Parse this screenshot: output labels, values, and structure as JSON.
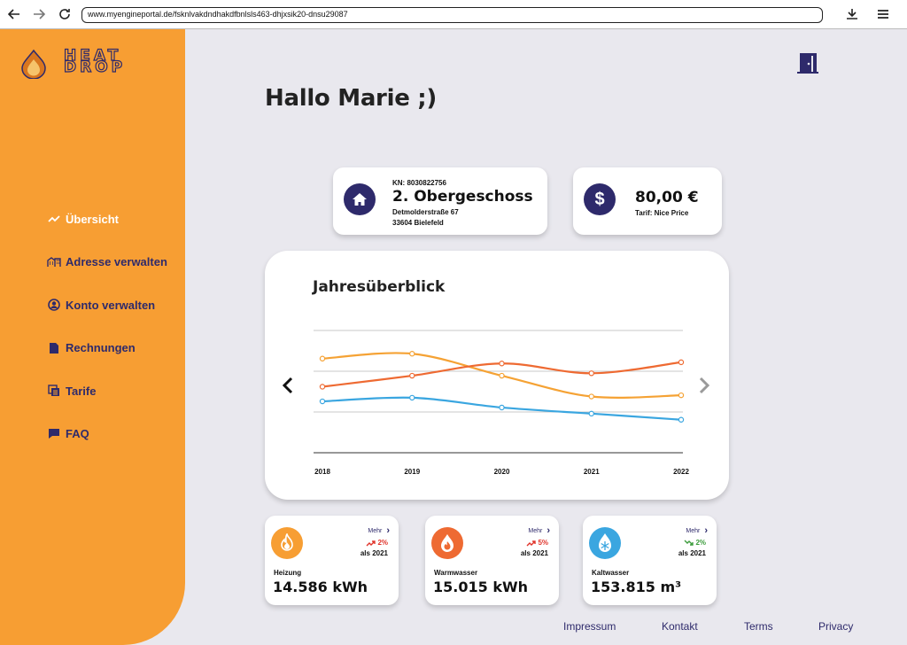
{
  "browser": {
    "url": "www.myengineportal.de/fsknlvakdndhakdfbnlsls463-dhjxsik20-dnsu29087"
  },
  "brand": {
    "logo_line1": "HEAT",
    "logo_line2": "DROP",
    "accent": "#f79e33",
    "navy": "#2e2a6b"
  },
  "sidebar": {
    "items": [
      {
        "label": "Übersicht",
        "icon": "trend-line-icon",
        "active": true
      },
      {
        "label": "Adresse verwalten",
        "icon": "buildings-icon",
        "active": false
      },
      {
        "label": "Konto verwalten",
        "icon": "account-icon",
        "active": false
      },
      {
        "label": "Rechnungen",
        "icon": "document-icon",
        "active": false
      },
      {
        "label": "Tarife",
        "icon": "tariff-icon",
        "active": false
      },
      {
        "label": "FAQ",
        "icon": "chat-icon",
        "active": false
      }
    ]
  },
  "greeting": "Hallo Marie ;)",
  "address_card": {
    "kn": "KN: 8030822756",
    "floor": "2. Obergeschoss",
    "street": "Detmolderstraße 67",
    "city": "33604 Bielefeld"
  },
  "price_card": {
    "price": "80,00 €",
    "tarif": "Tarif: Nice Price"
  },
  "chart": {
    "title": "Jahresüberblick"
  },
  "chart_data": {
    "type": "line",
    "title": "Jahresüberblick",
    "x": [
      "2018",
      "2019",
      "2020",
      "2021",
      "2022"
    ],
    "ylim": [
      0,
      100
    ],
    "grid": true,
    "series": [
      {
        "color": "#f5a234",
        "values": [
          77,
          81,
          63,
          46,
          47
        ]
      },
      {
        "color": "#ee6a32",
        "values": [
          54,
          63,
          73,
          65,
          74
        ]
      },
      {
        "color": "#3aa6e0",
        "values": [
          42,
          45,
          37,
          32,
          27
        ]
      }
    ]
  },
  "stats": [
    {
      "label": "Heizung",
      "value": "14.586 kWh",
      "mehr": "Mehr",
      "trend": "2%",
      "trend_dir": "up",
      "trend_color": "#e0332a",
      "vs": "als 2021",
      "icon": "flame-icon",
      "color": "#f79e33"
    },
    {
      "label": "Warmwasser",
      "value": "15.015 kWh",
      "mehr": "Mehr",
      "trend": "5%",
      "trend_dir": "up",
      "trend_color": "#e0332a",
      "vs": "als 2021",
      "icon": "hot-water-drop-icon",
      "color": "#ee6a32"
    },
    {
      "label": "Kaltwasser",
      "value": "153.815 m³",
      "mehr": "Mehr",
      "trend": "2%",
      "trend_dir": "down",
      "trend_color": "#3c9c3c",
      "vs": "als 2021",
      "icon": "snowflake-drop-icon",
      "color": "#3aa6e0"
    }
  ],
  "footer": {
    "links": [
      "Impressum",
      "Kontakt",
      "Terms",
      "Privacy"
    ]
  }
}
